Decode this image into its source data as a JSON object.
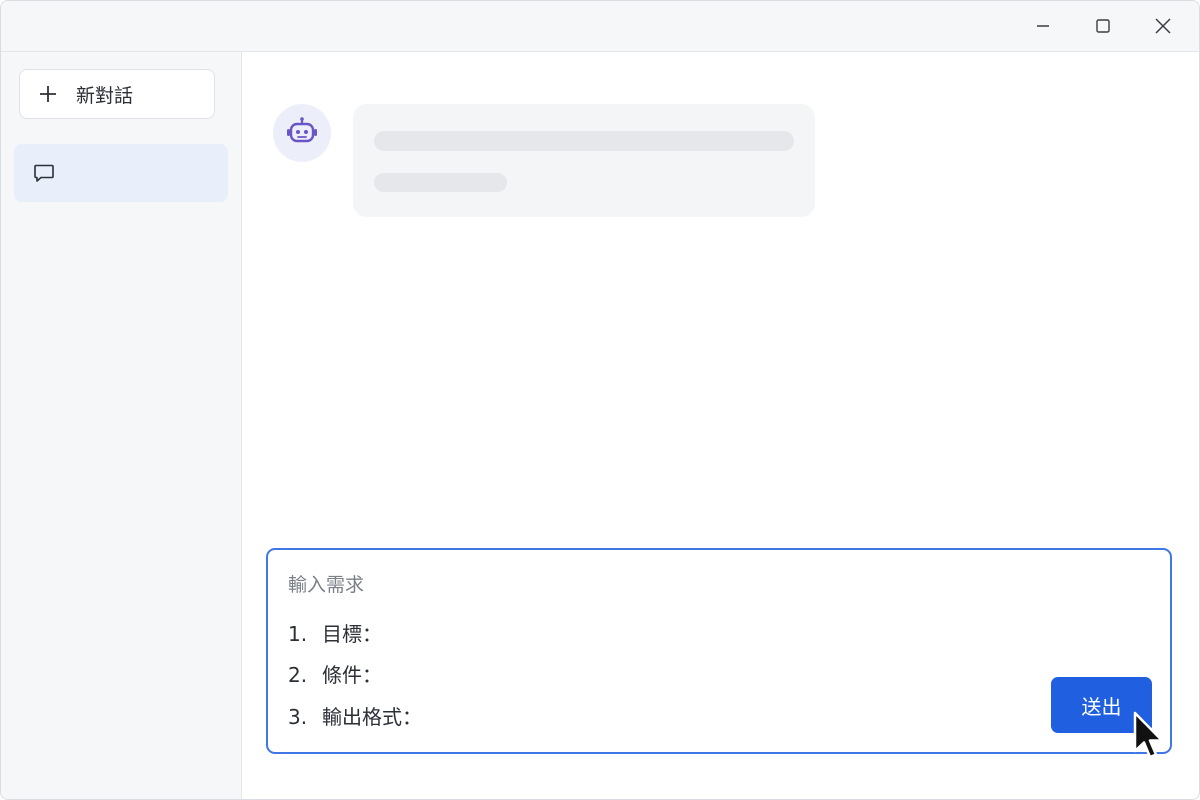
{
  "titlebar": {
    "controls": [
      {
        "name": "minimize-icon"
      },
      {
        "name": "maximize-icon"
      },
      {
        "name": "close-icon"
      }
    ]
  },
  "sidebar": {
    "new_chat_label": "新對話",
    "new_chat_icon": "plus-icon",
    "conversations": [
      {
        "icon": "chat-bubble-icon",
        "selected": true
      }
    ]
  },
  "chat": {
    "assistant_avatar_icon": "robot-icon",
    "assistant_message_state": "loading"
  },
  "composer": {
    "placeholder": "輸入需求",
    "lines": [
      {
        "number": "1.",
        "text": "目標："
      },
      {
        "number": "2.",
        "text": "條件："
      },
      {
        "number": "3.",
        "text": "輸出格式："
      }
    ],
    "send_label": "送出"
  },
  "colors": {
    "accent": "#1f5fe0",
    "composer_border": "#3f77e6",
    "selected_item_bg": "#e9eefb",
    "avatar_bg": "#eceefa",
    "robot_icon": "#6b54c8"
  }
}
